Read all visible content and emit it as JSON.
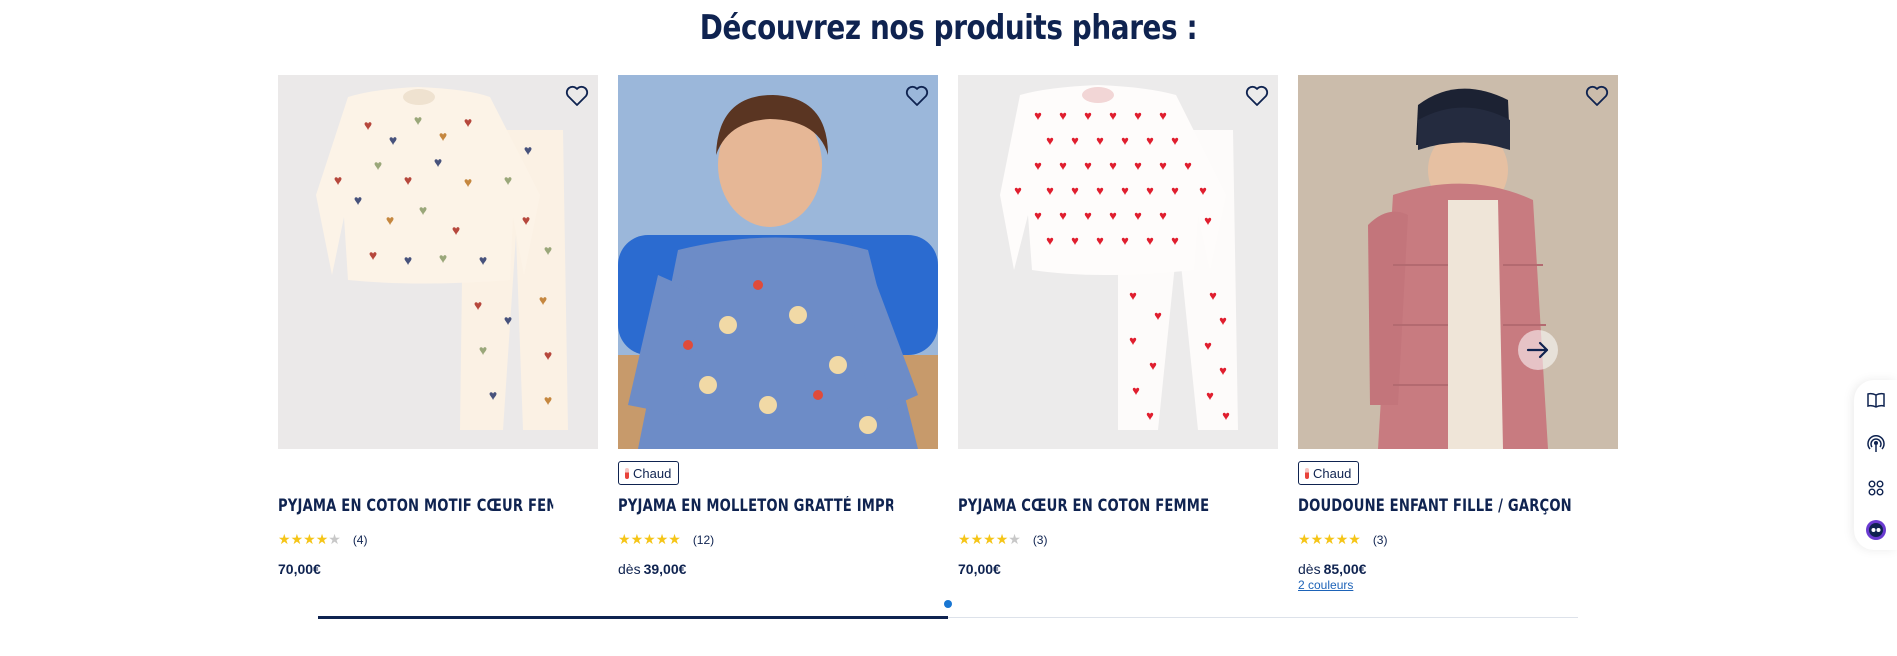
{
  "section": {
    "title": "Découvrez nos produits phares :"
  },
  "products": [
    {
      "name": "PYJAMA EN COTON MOTIF CŒUR FEMME",
      "badge": "",
      "rating": 4,
      "reviews": "(4)",
      "price_prefix": "",
      "price": "70,00€",
      "colors_link": ""
    },
    {
      "name": "PYJAMA EN MOLLETON GRATTÉ IMPRIMÉ ...",
      "badge": "Chaud",
      "rating": 5,
      "reviews": "(12)",
      "price_prefix": "dès",
      "price": "39,00€",
      "colors_link": ""
    },
    {
      "name": "PYJAMA CŒUR EN COTON FEMME",
      "badge": "",
      "rating": 4,
      "reviews": "(3)",
      "price_prefix": "",
      "price": "70,00€",
      "colors_link": ""
    },
    {
      "name": "DOUDOUNE ENFANT FILLE / GARÇON",
      "badge": "Chaud",
      "rating": 5,
      "reviews": "(3)",
      "price_prefix": "dès",
      "price": "85,00€",
      "colors_link": "2 couleurs"
    }
  ],
  "carousel": {
    "progress": 0.5,
    "active_page": 1
  },
  "icons": {
    "favorite": "heart-outline-icon",
    "next": "arrow-right-icon",
    "side_tools": [
      "book-icon",
      "podcast-icon",
      "grid-icon",
      "chatbot-icon"
    ]
  },
  "colors": {
    "brand_navy": "#0f2350",
    "star": "#f5c518",
    "link": "#1d63b8",
    "dot": "#1976d2"
  }
}
